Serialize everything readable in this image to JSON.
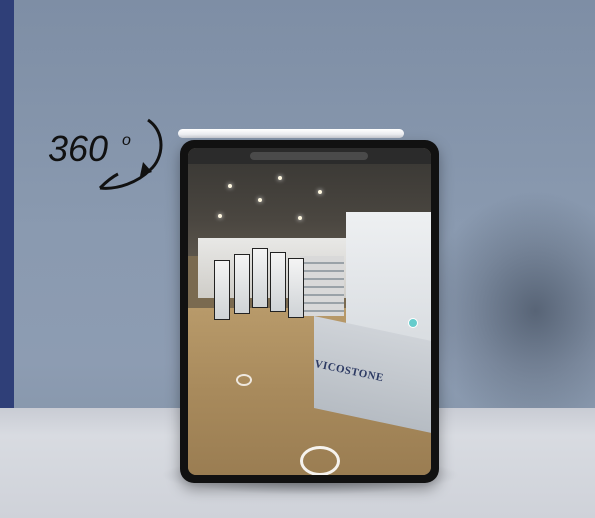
{
  "badge": {
    "number": "360",
    "degree_symbol": "o",
    "icon": "rotate-arrow-icon"
  },
  "scene": {
    "brand_text": "VICOSTONE"
  },
  "colors": {
    "wall": "#8a9ab0",
    "table": "#d3d6dc",
    "brand_blue": "#2d3a63"
  }
}
